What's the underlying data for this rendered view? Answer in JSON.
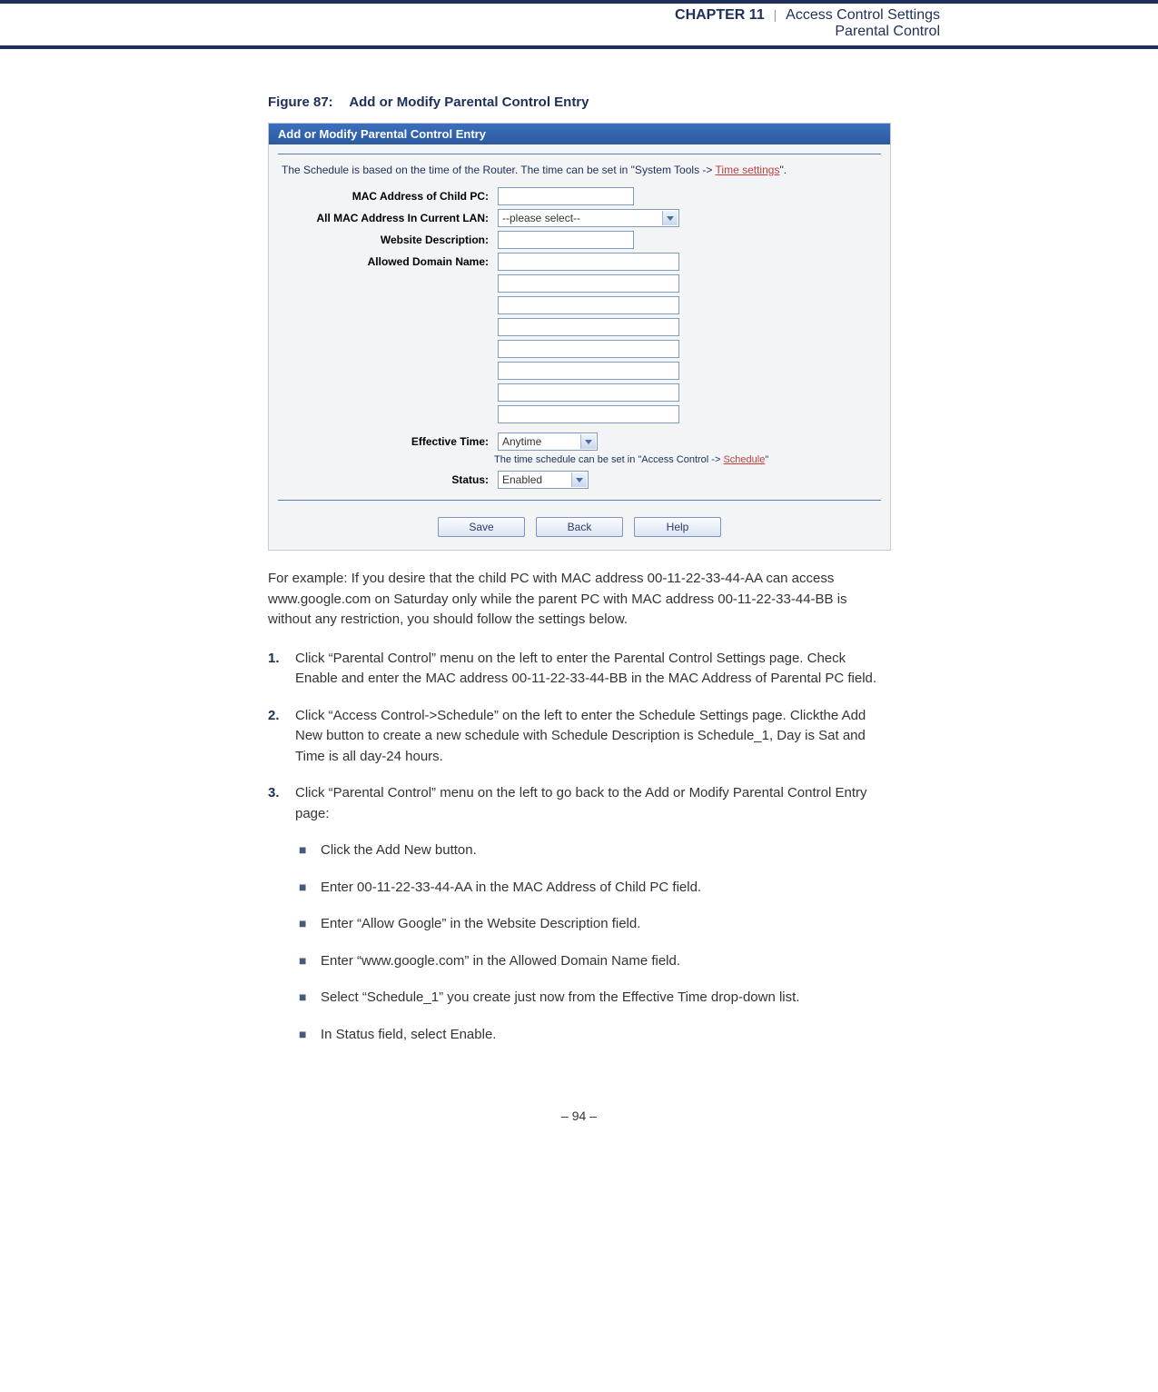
{
  "header": {
    "chapter": "CHAPTER 11",
    "separator": "|",
    "title": "Access Control Settings",
    "subtitle": "Parental Control"
  },
  "figure": {
    "number": "Figure 87:",
    "title": "Add or Modify Parental Control Entry"
  },
  "panel": {
    "title": "Add or Modify Parental Control Entry",
    "note_prefix": "The Schedule is based on the time of the Router. The time can be set in \"System Tools -> ",
    "note_link": "Time settings",
    "note_suffix": "\".",
    "labels": {
      "mac_child": "MAC Address of Child PC:",
      "all_mac": "All MAC Address In Current LAN:",
      "website_desc": "Website Description:",
      "allowed_domain": "Allowed Domain Name:",
      "effective_time": "Effective Time:",
      "status": "Status:"
    },
    "values": {
      "all_mac_select": "--please select--",
      "effective_time_select": "Anytime",
      "status_select": "Enabled"
    },
    "hint_prefix": "The time schedule can be set in \"Access Control -> ",
    "hint_link": "Schedule",
    "hint_suffix": "\"",
    "buttons": {
      "save": "Save",
      "back": "Back",
      "help": "Help"
    }
  },
  "body": {
    "intro": "For example: If you desire that the child PC with MAC address 00-11-22-33-44-AA can access www.google.com on Saturday only while the parent PC with MAC address 00-11-22-33-44-BB is without any restriction, you should follow the settings below.",
    "steps": [
      "Click “Parental Control” menu on the left to enter the Parental Control Settings page. Check Enable and enter the MAC address 00-11-22-33-44-BB in the MAC Address of Parental PC field.",
      "Click “Access Control->Schedule” on the left to enter the Schedule Settings page. Clickthe Add New button to create a new schedule with Schedule Description is Schedule_1, Day is Sat and Time is all day-24 hours.",
      "Click “Parental Control” menu on the left to go back to the Add or Modify Parental Control Entry page:"
    ],
    "sub_items": [
      "Click the Add New button.",
      "Enter 00-11-22-33-44-AA in the MAC Address of Child PC field.",
      "Enter “Allow Google” in the Website Description field.",
      "Enter “www.google.com” in the Allowed Domain Name field.",
      "Select “Schedule_1” you create just now from the Effective Time drop-down list.",
      "In Status field, select Enable."
    ]
  },
  "footer": {
    "page": "–  94  –"
  }
}
